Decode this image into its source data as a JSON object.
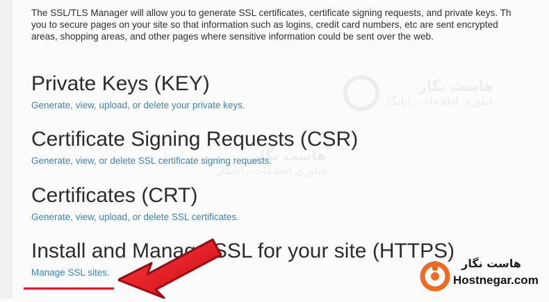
{
  "intro": {
    "line1": "The SSL/TLS Manager will allow you to generate SSL certificates, certificate signing requests, and private keys. Th",
    "line2": "you to secure pages on your site so that information such as logins, credit card numbers, etc are sent encrypted",
    "line3": "areas, shopping areas, and other pages where sensitive information could be sent over the web."
  },
  "sections": [
    {
      "title": "Private Keys (KEY)",
      "link": "Generate, view, upload, or delete your private keys."
    },
    {
      "title": "Certificate Signing Requests (CSR)",
      "link": "Generate, view, or delete SSL certificate signing requests."
    },
    {
      "title": "Certificates (CRT)",
      "link": "Generate, view, upload, or delete SSL certificates."
    },
    {
      "title": "Install and Manage SSL for your site (HTTPS)",
      "link": "Manage SSL sites."
    }
  ],
  "watermark": {
    "title": "هاست نگار",
    "subtitle": "فناوری اطلاعات رایانگار"
  },
  "brand": {
    "persian": "هاست نگار",
    "english": "Hostnegar.com",
    "accent_color": "#f26a21"
  },
  "colors": {
    "link": "#3a83c4",
    "highlight_arrow": "#e3182a"
  }
}
